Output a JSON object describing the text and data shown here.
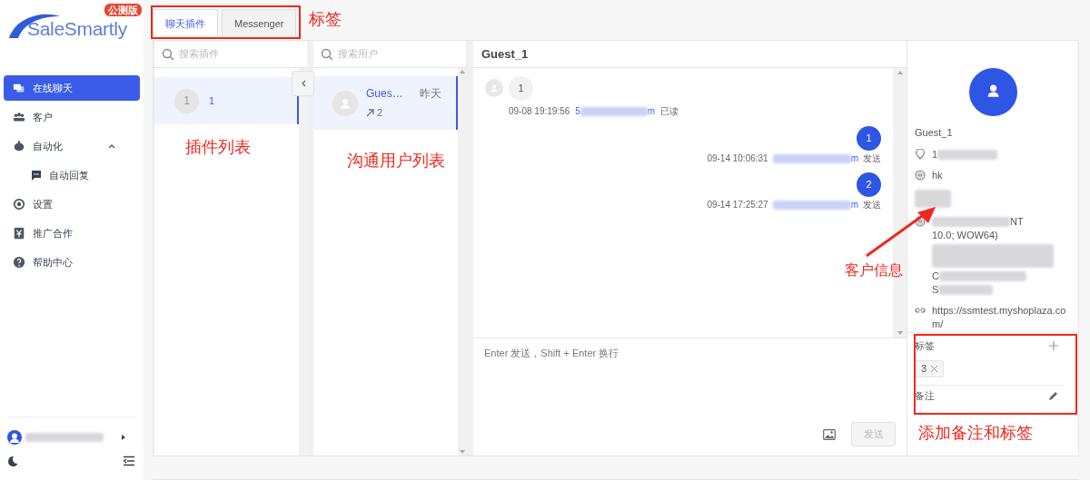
{
  "logo": {
    "text": "SaleSmartly",
    "badge": "公测版"
  },
  "sidebar": {
    "items": [
      {
        "label": "在线聊天",
        "selected": true
      },
      {
        "label": "客户",
        "selected": false
      },
      {
        "label": "自动化",
        "selected": false,
        "expanded": true,
        "children": [
          {
            "label": "自动回复",
            "selected": false
          }
        ]
      },
      {
        "label": "设置",
        "selected": false
      },
      {
        "label": "推广合作",
        "selected": false
      },
      {
        "label": "帮助中心",
        "selected": false
      }
    ]
  },
  "tabs": [
    {
      "label": "聊天插件",
      "selected": true
    },
    {
      "label": "Messenger",
      "selected": false
    }
  ],
  "plugins": {
    "search": {
      "placeholder": "搜索插件"
    },
    "items": [
      {
        "avatar": "1",
        "name": "1",
        "selected": true
      }
    ]
  },
  "users": {
    "search": {
      "placeholder": "搜索用户"
    },
    "items": [
      {
        "name": "Gues…",
        "time": "昨天",
        "count": "2",
        "selected": true
      }
    ]
  },
  "chat": {
    "title": "Guest_1",
    "messages": [
      {
        "kind": "incoming",
        "text": "1",
        "time": "09-08 19:19:56",
        "sender_start": "5",
        "sender_end": "m",
        "status": "已读"
      },
      {
        "kind": "outgoing",
        "text": "1",
        "time": "09-14 10:06:31",
        "sender_end": "m",
        "status": "发送"
      },
      {
        "kind": "outgoing",
        "text": "2",
        "time": "09-14 17:25:27",
        "sender_end": "m",
        "status": "发送"
      }
    ],
    "composer": {
      "placeholder": "Enter 发送，Shift + Enter 换行"
    },
    "send_button": {
      "label": "发送",
      "disabled": true
    }
  },
  "customer": {
    "name": "Guest_1",
    "fields": [
      {
        "kind": "location",
        "lines": [
          "1"
        ]
      },
      {
        "kind": "region",
        "lines": [
          "hk"
        ]
      },
      {
        "kind": "hidden"
      },
      {
        "kind": "device",
        "lines": [
          "NT",
          "10.0; WOW64)",
          "C",
          "S"
        ]
      },
      {
        "kind": "url",
        "lines": [
          "https://ssmtest.myshoplaza.com/"
        ]
      }
    ],
    "tags": {
      "title": "标签",
      "items": [
        "3"
      ]
    },
    "notes": {
      "title": "备注"
    }
  },
  "annotations": {
    "tabs_label": "标签",
    "plugin_list_label": "插件列表",
    "user_list_label": "沟通用户列表",
    "customer_info_label": "客户信息",
    "tags_notes_label": "添加备注和标签"
  }
}
